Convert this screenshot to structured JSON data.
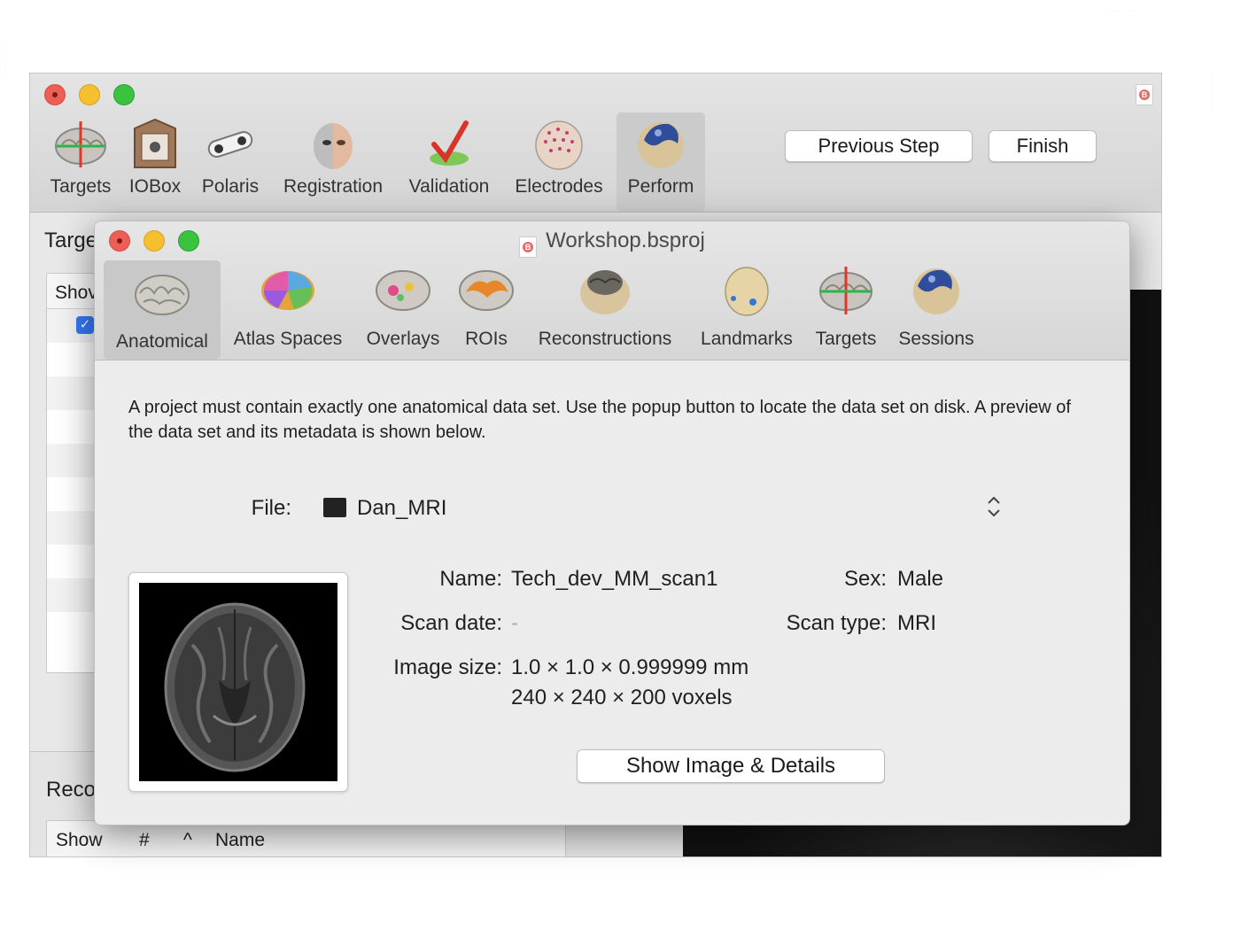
{
  "back_window": {
    "toolbar": [
      {
        "label": "Targets",
        "icon": "targets-brain-icon"
      },
      {
        "label": "IOBox",
        "icon": "iobox-icon"
      },
      {
        "label": "Polaris",
        "icon": "polaris-camera-icon"
      },
      {
        "label": "Registration",
        "icon": "registration-face-icon"
      },
      {
        "label": "Validation",
        "icon": "validation-check-icon"
      },
      {
        "label": "Electrodes",
        "icon": "electrodes-head-icon"
      },
      {
        "label": "Perform",
        "icon": "perform-head-icon"
      }
    ],
    "previous_step_label": "Previous Step",
    "finish_label": "Finish",
    "targets_section_label": "Targe",
    "table_show_header": "Shov",
    "recordings_section_label": "Reco",
    "bottom_columns": {
      "show": "Show",
      "number": "#",
      "sort": "^",
      "name": "Name"
    }
  },
  "front_window": {
    "title": "Workshop.bsproj",
    "toolbar": [
      {
        "label": "Anatomical",
        "icon": "anatomical-brain-icon",
        "selected": true
      },
      {
        "label": "Atlas Spaces",
        "icon": "atlas-brain-icon"
      },
      {
        "label": "Overlays",
        "icon": "overlays-brain-icon"
      },
      {
        "label": "ROIs",
        "icon": "rois-brain-icon"
      },
      {
        "label": "Reconstructions",
        "icon": "reconstructions-head-icon"
      },
      {
        "label": "Landmarks",
        "icon": "landmarks-head-icon"
      },
      {
        "label": "Targets",
        "icon": "targets-brain-icon"
      },
      {
        "label": "Sessions",
        "icon": "sessions-head-icon"
      }
    ],
    "description": "A project must contain exactly one anatomical data set. Use the popup button to locate the data set on disk. A preview of the data set and its metadata is shown below.",
    "file_label": "File:",
    "file_value": "Dan_MRI",
    "metadata": {
      "name_label": "Name:",
      "name_value": "Tech_dev_MM_scan1",
      "sex_label": "Sex:",
      "sex_value": "Male",
      "scan_date_label": "Scan date:",
      "scan_date_value": "-",
      "scan_type_label": "Scan type:",
      "scan_type_value": "MRI",
      "image_size_label": "Image size:",
      "image_size_value": "1.0 × 1.0 × 0.999999 mm",
      "voxels_value": "240 × 240 × 200 voxels"
    },
    "show_details_label": "Show Image & Details"
  }
}
